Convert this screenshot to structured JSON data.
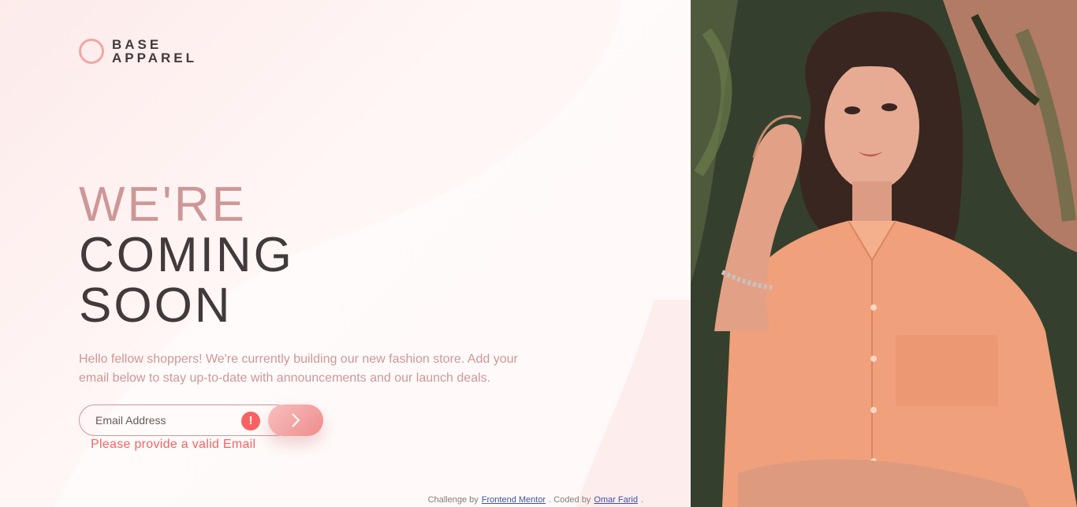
{
  "brand": {
    "line1": "BASE",
    "line2": "APPAREL"
  },
  "headline": {
    "light": "WE'RE",
    "dark_line1": "COMING",
    "dark_line2": "SOON"
  },
  "intro": "Hello fellow shoppers! We're currently building our new fashion store. Add your email below to stay up-to-date with announcements and our launch deals.",
  "form": {
    "email_placeholder": "Email Address",
    "email_value": "",
    "error_icon_glyph": "!",
    "error_message": "Please provide a valid Email"
  },
  "attribution": {
    "prefix": "Challenge by",
    "challenge_link": "Frontend Mentor",
    "middle": ". Coded by",
    "author_link": "Omar Farid",
    "suffix": "."
  },
  "colors": {
    "accent": "#ce9797",
    "text_dark": "#423a3a",
    "error": "#f96262",
    "button_start": "#f8bfbf",
    "button_end": "#ee8c8c",
    "link": "#3e52a3"
  },
  "icons": {
    "submit": "arrow-right-icon",
    "error": "exclamation-icon",
    "logo": "ring-logo-icon"
  }
}
